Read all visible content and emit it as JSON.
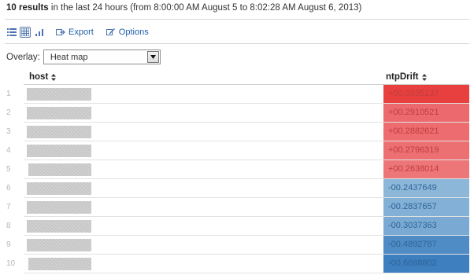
{
  "summary": {
    "count_bold": "10 results",
    "rest": " in the last 24 hours (from 8:00:00 AM August 5 to 8:02:28 AM August 6, 2013)"
  },
  "toolbar": {
    "export_label": "Export",
    "options_label": "Options",
    "icons": [
      "list-icon",
      "table-icon",
      "chart-icon"
    ]
  },
  "overlay": {
    "label": "Overlay:",
    "selected": "Heat map"
  },
  "table": {
    "headers": {
      "host": "host",
      "ntpDrift": "ntpDrift"
    },
    "rows": [
      {
        "num": "1",
        "drift": "+00.3935137",
        "color": "#e8403f"
      },
      {
        "num": "2",
        "drift": "+00.2910521",
        "color": "#ec6a6d"
      },
      {
        "num": "3",
        "drift": "+00.2882621",
        "color": "#ec6c6f"
      },
      {
        "num": "4",
        "drift": "+00.2796319",
        "color": "#ec6f72"
      },
      {
        "num": "5",
        "drift": "+00.2638014",
        "color": "#ed7679"
      },
      {
        "num": "6",
        "drift": "-00.2437649",
        "color": "#8cb7d9"
      },
      {
        "num": "7",
        "drift": "-00.2837657",
        "color": "#82b0d6"
      },
      {
        "num": "8",
        "drift": "-00.3037363",
        "color": "#7aaad3"
      },
      {
        "num": "9",
        "drift": "-00.4892787",
        "color": "#4f8cc5"
      },
      {
        "num": "10",
        "drift": "-00.6688802",
        "color": "#3d7fbf"
      }
    ]
  }
}
